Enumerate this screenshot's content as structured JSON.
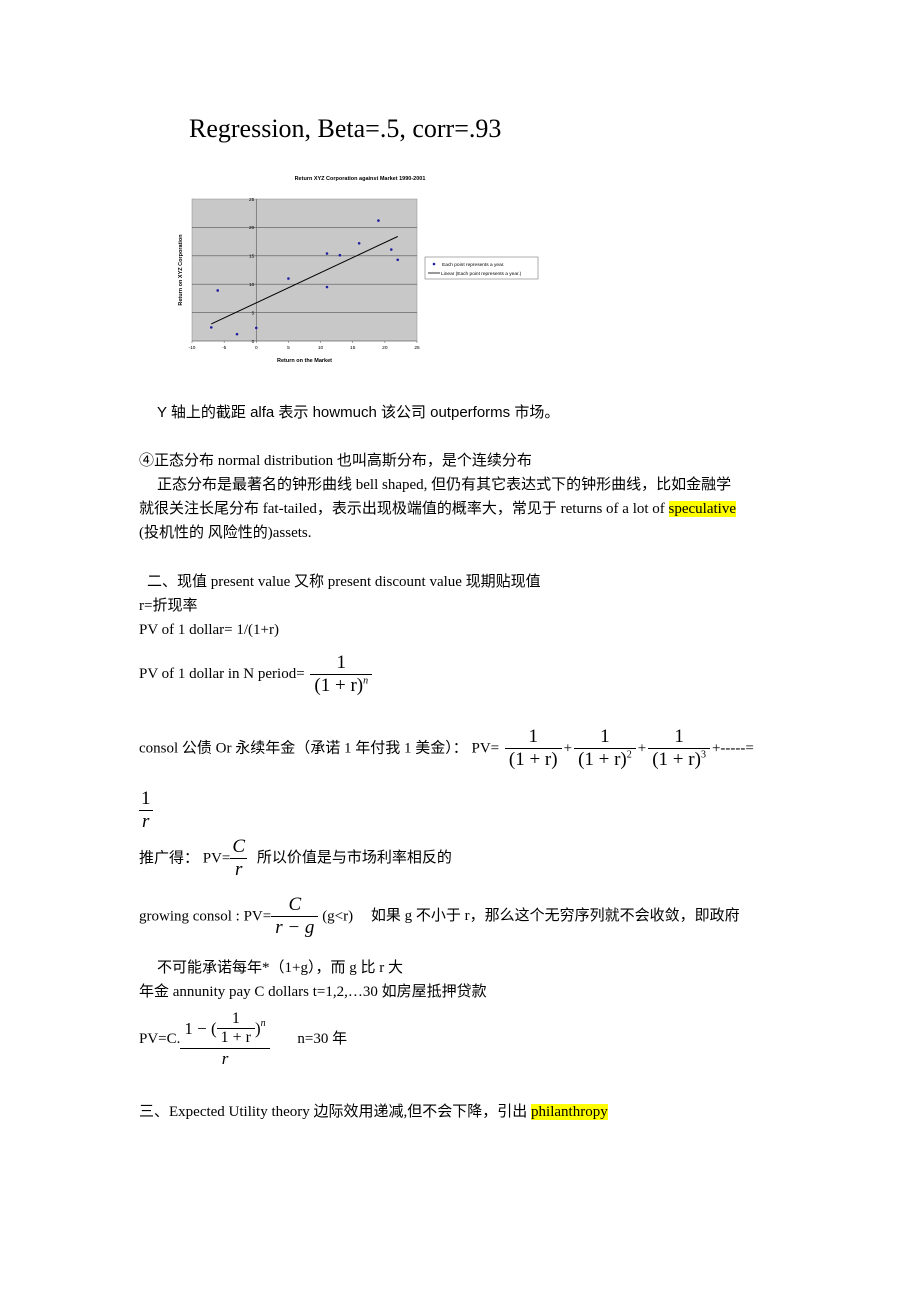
{
  "heading": "Regression, Beta=.5, corr=.93",
  "chart_data": {
    "type": "scatter",
    "title": "Return XYZ Corporation against Market 1990-2001",
    "xlabel": "Return on the Market",
    "ylabel": "Return on XYZ Corporation",
    "xlim": [
      -10,
      25
    ],
    "ylim": [
      0,
      25
    ],
    "xticks": [
      "-10",
      "-5",
      "0",
      "5",
      "10",
      "15",
      "20",
      "25"
    ],
    "yticks": [
      "0",
      "5",
      "10",
      "15",
      "20",
      "25"
    ],
    "grid": "horizontal",
    "legend_position": "right",
    "series": [
      {
        "name": "Each point represents a year.",
        "type": "scatter",
        "color": "#1f1fa0",
        "points": [
          {
            "x": -7,
            "y": 2.4
          },
          {
            "x": -6,
            "y": 8.9
          },
          {
            "x": -3,
            "y": 1.2
          },
          {
            "x": 0,
            "y": 2.3
          },
          {
            "x": 5,
            "y": 11.0
          },
          {
            "x": 11,
            "y": 15.4
          },
          {
            "x": 11,
            "y": 9.5
          },
          {
            "x": 13,
            "y": 15.1
          },
          {
            "x": 16,
            "y": 17.2
          },
          {
            "x": 19,
            "y": 21.2
          },
          {
            "x": 21,
            "y": 16.1
          },
          {
            "x": 22,
            "y": 14.3
          }
        ]
      },
      {
        "name": "Linear (Each point represents a year.)",
        "type": "line",
        "color": "#000000",
        "points": [
          {
            "x": -7,
            "y": 3.0
          },
          {
            "x": 22,
            "y": 18.4
          }
        ]
      }
    ]
  },
  "text": {
    "alpha_note": "Y 轴上的截距 alfa 表示 howmuch 该公司 outperforms 市场。",
    "normal_title": "④正态分布  normal distribution  也叫高斯分布，是个连续分布",
    "normal_p1": "正态分布是最著名的钟形曲线 bell shaped, 但仍有其它表达式下的钟形曲线，比如金融学",
    "normal_p2_pre": "就很关注长尾分布 fat-tailed，表示出现极端值的概率大，常见于 returns of a lot of ",
    "normal_p2_hl": "speculative",
    "normal_p3": "(投机性的  风险性的)assets.",
    "pv_title": "二、现值  present value  又称 present discount value  现期贴现值",
    "r_def": "r=折现率",
    "pv1": "PV of 1 dollar= 1/(1+r)",
    "pvN_label": "PV of 1 dollar in N period=",
    "consol_label": "consol 公债  Or  永续年金（承诺 1 年付我 1 美金）：  PV=",
    "consol_tail": "+-----=",
    "generalize_label": "推广得：  PV=",
    "generalize_note": "所以价值是与市场利率相反的",
    "growing_label": "growing consol :    PV=",
    "growing_cond": "(g<r)",
    "growing_note": "如果 g 不小于 r，那么这个无穷序列就不会收敛，即政府",
    "growing_note2": "不可能承诺每年*（1+g），而 g 比 r 大",
    "annuity": "年金  annunity pay C dollars    t=1,2,…30  如房屋抵押贷款",
    "annuity_label": "PV=C.",
    "annuity_n": "n=30 年",
    "eu_pre": "三、Expected Utility theory 边际效用递减,但不会下降，引出 ",
    "eu_hl": "philanthropy"
  },
  "math": {
    "one": "1",
    "C": "C",
    "r": "r",
    "one_plus_r": "(1 + r)",
    "n": "n",
    "two": "2",
    "three": "3",
    "plus": "+",
    "r_minus_g": "r − g",
    "one_minus": "1 − (",
    "close_paren": ")",
    "one_plus_r_nb": "1 + r"
  }
}
